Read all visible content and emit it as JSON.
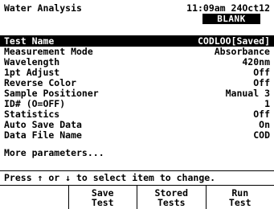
{
  "header": {
    "title": "Water Analysis",
    "time": "11:09am 24Oct12",
    "status_badge": "BLANK"
  },
  "selected_item": {
    "label": "Test Name",
    "value": "CODLOO[Saved]"
  },
  "params": [
    {
      "label": "Measurement Mode",
      "value": "Absorbance"
    },
    {
      "label": "Wavelength",
      "value": "420nm"
    },
    {
      "label": "1pt Adjust",
      "value": "Off"
    },
    {
      "label": "Reverse Color",
      "value": "Off"
    },
    {
      "label": "Sample Positioner",
      "value": "Manual 3"
    },
    {
      "label": "ID# (O=OFF)",
      "value": "1"
    },
    {
      "label": "Statistics",
      "value": "Off"
    },
    {
      "label": "Auto Save Data",
      "value": "On"
    },
    {
      "label": "Data File Name",
      "value": "COD"
    }
  ],
  "more_params": "More parameters...",
  "hint": "Press ↑ or ↓ to select item to change.",
  "soft_keys": [
    {
      "line1": "",
      "line2": ""
    },
    {
      "line1": "Save",
      "line2": "Test"
    },
    {
      "line1": "Stored",
      "line2": "Tests"
    },
    {
      "line1": "Run",
      "line2": "Test"
    }
  ]
}
